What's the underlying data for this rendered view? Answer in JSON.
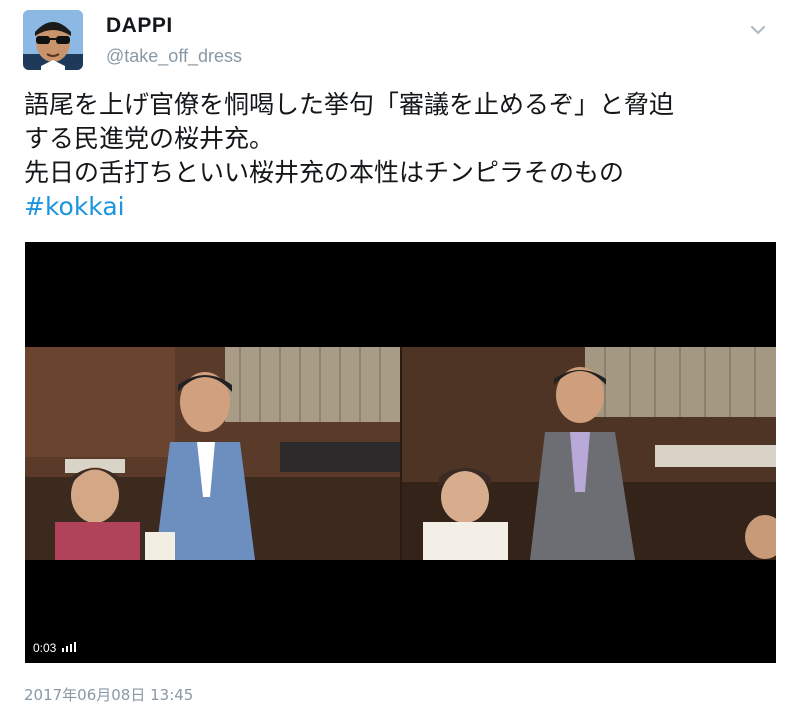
{
  "author": {
    "display_name": "DAPPI",
    "handle": "@take_off_dress"
  },
  "tweet": {
    "lines": [
      "語尾を上げ官僚を恫喝した挙句「審議を止めるぞ」と脅迫",
      "する民進党の桜井充。",
      "先日の舌打ちといい桜井充の本性はチンピラそのもの"
    ],
    "hashtag": "#kokkai"
  },
  "video": {
    "elapsed": "0:03"
  },
  "timestamp": "2017年06月08日 13:45",
  "colors": {
    "link": "#1b95e0",
    "secondary_text": "#8899a6",
    "video_bg": "#000000"
  },
  "icons": {
    "menu": "chevron-down-icon",
    "volume": "volume-bars-icon"
  }
}
